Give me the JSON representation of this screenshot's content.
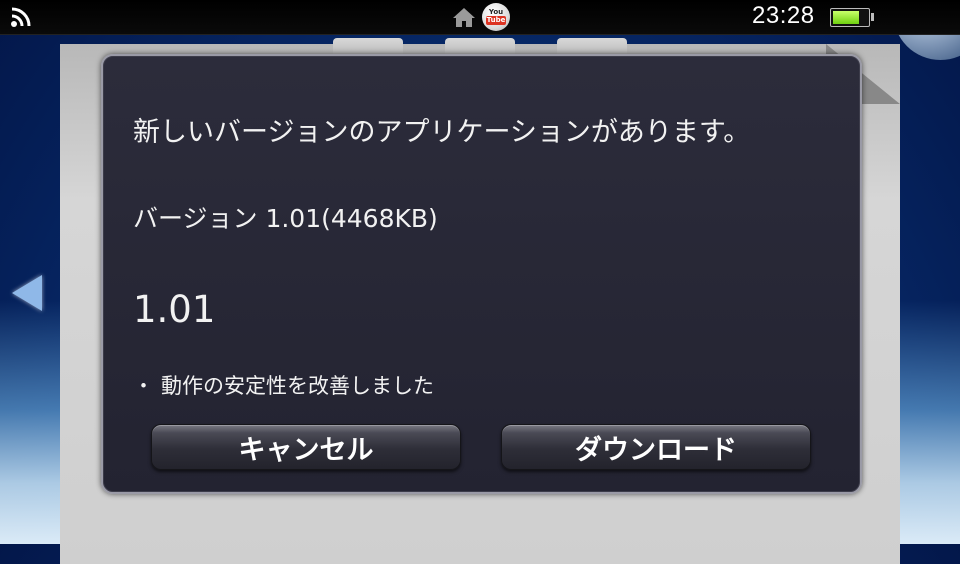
{
  "status_bar": {
    "time": "23:28",
    "battery_level": 0.8,
    "youtube_icon_text_top": "You",
    "youtube_icon_text_bottom": "Tube",
    "icons": [
      "wifi-icon",
      "home-icon",
      "youtube-icon",
      "battery-icon"
    ]
  },
  "dialog": {
    "message": "新しいバージョンのアプリケーションがあります。",
    "version_line": "バージョン 1.01(4468KB)",
    "version_number": "1.01",
    "notes": [
      {
        "bullet": "・",
        "text": "動作の安定性を改善しました"
      }
    ],
    "buttons": {
      "cancel": "キャンセル",
      "download": "ダウンロード"
    }
  },
  "colors": {
    "dialog_bg": "#2a2a39",
    "text": "#f2f2f2",
    "battery_fill": "#8ee52a"
  }
}
